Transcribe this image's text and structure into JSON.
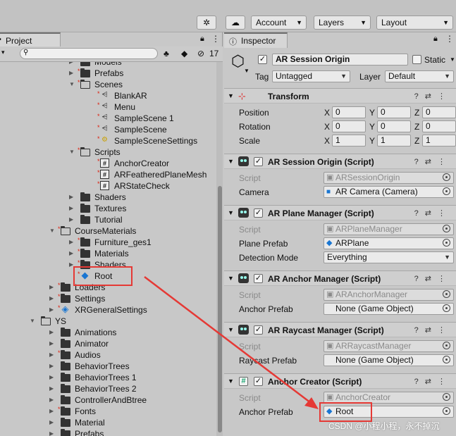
{
  "toolbar": {
    "account_label": "Account",
    "layers_label": "Layers",
    "layout_label": "Layout"
  },
  "project": {
    "tab_label": "Project",
    "hidden_count": "17",
    "tree": [
      {
        "label": "Models",
        "indent": 3,
        "type": "folder",
        "arrow": "collapsed",
        "star": true
      },
      {
        "label": "Prefabs",
        "indent": 3,
        "type": "folder",
        "arrow": "collapsed",
        "star": true
      },
      {
        "label": "Scenes",
        "indent": 3,
        "type": "folder-open",
        "arrow": "expanded",
        "star": true
      },
      {
        "label": "BlankAR",
        "indent": 4,
        "type": "scene",
        "star": true
      },
      {
        "label": "Menu",
        "indent": 4,
        "type": "scene",
        "star": true
      },
      {
        "label": "SampleScene 1",
        "indent": 4,
        "type": "scene",
        "star": true
      },
      {
        "label": "SampleScene",
        "indent": 4,
        "type": "scene",
        "star": true
      },
      {
        "label": "SampleSceneSettings",
        "indent": 4,
        "type": "settings",
        "star": true
      },
      {
        "label": "Scripts",
        "indent": 3,
        "type": "folder-open",
        "arrow": "expanded",
        "star": true
      },
      {
        "label": "AnchorCreator",
        "indent": 4,
        "type": "script",
        "star": true
      },
      {
        "label": "ARFeatheredPlaneMesh",
        "indent": 4,
        "type": "script",
        "star": true
      },
      {
        "label": "ARStateCheck",
        "indent": 4,
        "type": "script",
        "star": true
      },
      {
        "label": "Shaders",
        "indent": 3,
        "type": "folder",
        "arrow": "collapsed",
        "star": false
      },
      {
        "label": "Textures",
        "indent": 3,
        "type": "folder",
        "arrow": "collapsed",
        "star": false
      },
      {
        "label": "Tutorial",
        "indent": 3,
        "type": "folder",
        "arrow": "collapsed",
        "star": false
      },
      {
        "label": "CourseMaterials",
        "indent": 2,
        "type": "folder-open",
        "arrow": "expanded",
        "star": true
      },
      {
        "label": "Furniture_ges1",
        "indent": 3,
        "type": "folder",
        "arrow": "collapsed",
        "star": true
      },
      {
        "label": "Materials",
        "indent": 3,
        "type": "folder",
        "arrow": "collapsed",
        "star": true
      },
      {
        "label": "Shaders",
        "indent": 3,
        "type": "folder",
        "arrow": "collapsed",
        "star": true
      },
      {
        "label": "Root",
        "indent": 3,
        "type": "prefab",
        "star": true,
        "highlight": true
      },
      {
        "label": "Loaders",
        "indent": 2,
        "type": "folder",
        "arrow": "collapsed",
        "star": true
      },
      {
        "label": "Settings",
        "indent": 2,
        "type": "folder",
        "arrow": "collapsed",
        "star": true
      },
      {
        "label": "XRGeneralSettings",
        "indent": 2,
        "type": "xrsettings",
        "arrow": "collapsed",
        "star": true
      },
      {
        "label": "YS",
        "indent": 1,
        "type": "folder-open",
        "arrow": "expanded",
        "star": false
      },
      {
        "label": "Animations",
        "indent": 2,
        "type": "folder",
        "arrow": "collapsed",
        "star": false
      },
      {
        "label": "Animator",
        "indent": 2,
        "type": "folder",
        "arrow": "collapsed",
        "star": false
      },
      {
        "label": "Audios",
        "indent": 2,
        "type": "folder",
        "arrow": "collapsed",
        "star": true
      },
      {
        "label": "BehaviorTrees",
        "indent": 2,
        "type": "folder",
        "arrow": "collapsed",
        "star": false
      },
      {
        "label": "BehaviorTrees 1",
        "indent": 2,
        "type": "folder",
        "arrow": "collapsed",
        "star": false
      },
      {
        "label": "BehaviorTrees 2",
        "indent": 2,
        "type": "folder",
        "arrow": "collapsed",
        "star": false
      },
      {
        "label": "ControllerAndBtree",
        "indent": 2,
        "type": "folder",
        "arrow": "collapsed",
        "star": false
      },
      {
        "label": "Fonts",
        "indent": 2,
        "type": "folder",
        "arrow": "collapsed",
        "star": true
      },
      {
        "label": "Material",
        "indent": 2,
        "type": "folder",
        "arrow": "collapsed",
        "star": false
      },
      {
        "label": "Prefabs",
        "indent": 2,
        "type": "folder",
        "arrow": "collapsed",
        "star": false
      }
    ]
  },
  "inspector": {
    "tab_label": "Inspector",
    "object_name": "AR Session Origin",
    "static_label": "Static",
    "tag_label": "Tag",
    "tag_value": "Untagged",
    "layer_label": "Layer",
    "layer_value": "Default",
    "transform": {
      "title": "Transform",
      "position_label": "Position",
      "rotation_label": "Rotation",
      "scale_label": "Scale",
      "x": "X",
      "y": "Y",
      "z": "Z",
      "position": [
        "0",
        "0",
        "0"
      ],
      "rotation": [
        "0",
        "0",
        "0"
      ],
      "scale": [
        "1",
        "1",
        "1"
      ]
    },
    "session_origin": {
      "title": "AR Session Origin (Script)",
      "script_label": "Script",
      "script_value": "ARSessionOrigin",
      "camera_label": "Camera",
      "camera_value": "AR Camera (Camera)"
    },
    "plane_manager": {
      "title": "AR Plane Manager (Script)",
      "script_label": "Script",
      "script_value": "ARPlaneManager",
      "prefab_label": "Plane Prefab",
      "prefab_value": "ARPlane",
      "detection_label": "Detection Mode",
      "detection_value": "Everything"
    },
    "anchor_manager": {
      "title": "AR Anchor Manager (Script)",
      "script_label": "Script",
      "script_value": "ARAnchorManager",
      "prefab_label": "Anchor Prefab",
      "prefab_value": "None (Game Object)"
    },
    "raycast_manager": {
      "title": "AR Raycast Manager (Script)",
      "script_label": "Script",
      "script_value": "ARRaycastManager",
      "prefab_label": "Raycast Prefab",
      "prefab_value": "None (Game Object)"
    },
    "anchor_creator": {
      "title": "Anchor Creator (Script)",
      "script_label": "Script",
      "script_value": "AnchorCreator",
      "prefab_label": "Anchor Prefab",
      "prefab_value": "Root"
    }
  },
  "watermark": "CSDN @小程小程，永不掉沉",
  "colors": {
    "annotation": "#e53935",
    "prefab_blue": "#1976d2"
  }
}
